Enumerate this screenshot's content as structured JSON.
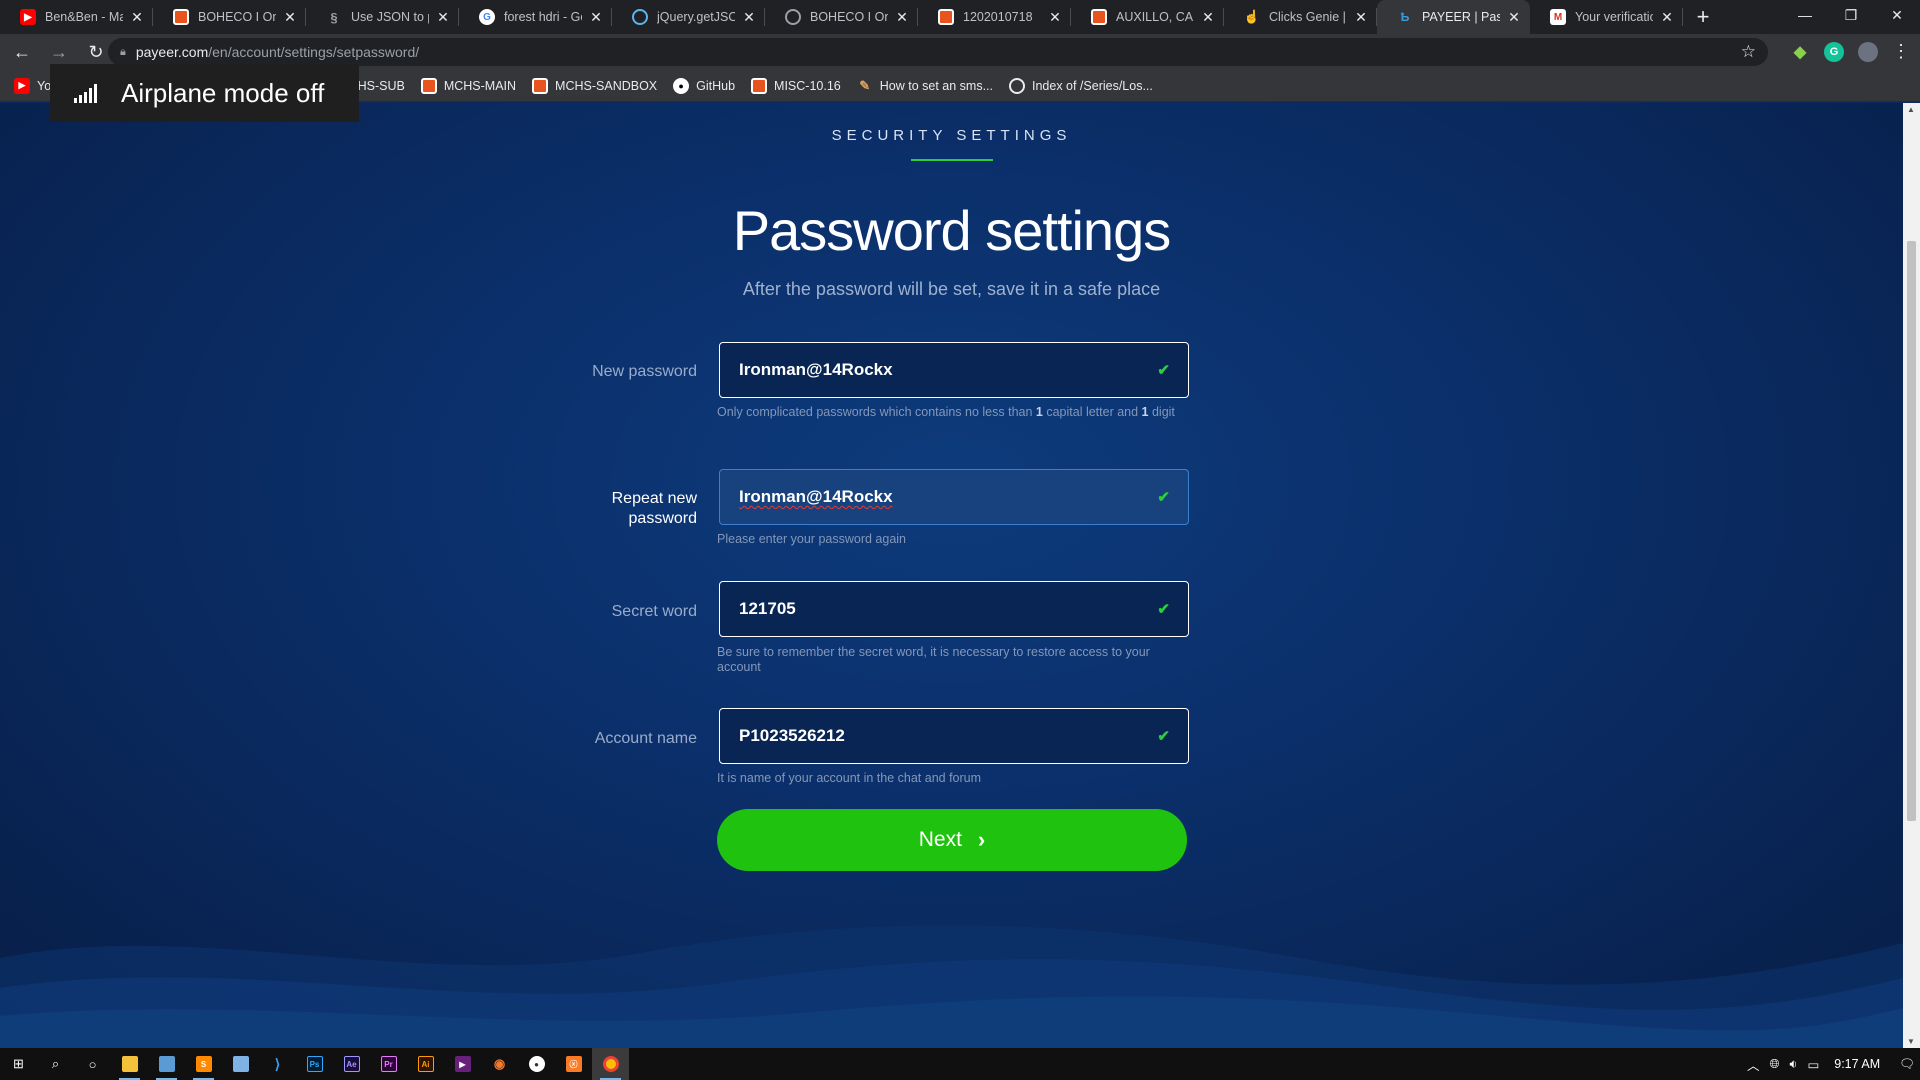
{
  "browser": {
    "tabs": [
      {
        "title": "Ben&Ben - Masy",
        "icon": "youtube-icon",
        "active": false
      },
      {
        "title": "BOHECO I Onlin",
        "icon": "boheco-icon",
        "active": false
      },
      {
        "title": "Use JSON to pas",
        "icon": "json-icon",
        "active": false
      },
      {
        "title": "forest hdri - Goo",
        "icon": "google-icon",
        "active": false
      },
      {
        "title": "jQuery.getJSON(",
        "icon": "jquery-icon",
        "active": false
      },
      {
        "title": "BOHECO I Onlin",
        "icon": "globe-icon",
        "active": false
      },
      {
        "title": "1202010718",
        "icon": "boheco-icon",
        "active": false
      },
      {
        "title": "AUXILLO, CALIX",
        "icon": "boheco-icon",
        "active": false
      },
      {
        "title": "Clicks Genie | Ge",
        "icon": "hand-icon",
        "active": false
      },
      {
        "title": "PAYEER | Passwo",
        "icon": "payeer-icon",
        "active": true
      },
      {
        "title": "Your verification",
        "icon": "gmail-icon",
        "active": false
      }
    ],
    "new_tab": "+",
    "url_host": "payeer.com",
    "url_path": "/en/account/settings/setpassword/",
    "bookmarks": [
      {
        "label": "Yo",
        "icon": "youtube-icon"
      },
      {
        "label": "MCHS-SUB",
        "icon": "boheco-icon"
      },
      {
        "label": "MCHS-MAIN",
        "icon": "boheco-icon"
      },
      {
        "label": "MCHS-SANDBOX",
        "icon": "boheco-icon"
      },
      {
        "label": "GitHub",
        "icon": "github-icon"
      },
      {
        "label": "MISC-10.16",
        "icon": "boheco-icon"
      },
      {
        "label": "How to set an sms...",
        "icon": "pin-icon"
      },
      {
        "label": "Index of /Series/Los...",
        "icon": "globe-icon"
      }
    ]
  },
  "toast": {
    "text": "Airplane mode off",
    "icon": "signal-icon"
  },
  "page": {
    "kicker": "SECURITY SETTINGS",
    "title": "Password settings",
    "subtitle": "After the password will be set, save it in a safe place",
    "fields": {
      "new_password": {
        "label": "New password",
        "value": "Ironman@14Rockx",
        "hint_pre": "Only complicated passwords which contains no less than ",
        "hint_b1": "1",
        "hint_mid": " capital letter and ",
        "hint_b2": "1",
        "hint_post": " digit"
      },
      "repeat_password": {
        "label_line1": "Repeat new",
        "label_line2": "password",
        "value": "Ironman@14Rockx",
        "hint": "Please enter your password again"
      },
      "secret_word": {
        "label": "Secret word",
        "value": "121705",
        "hint": "Be sure to remember the secret word, it is necessary to restore access to your account"
      },
      "account_name": {
        "label": "Account name",
        "value": "P1023526212",
        "hint": "It is name of your account in the chat and forum"
      }
    },
    "next_label": "Next"
  },
  "taskbar": {
    "clock": "9:17 AM"
  },
  "colors": {
    "accent_green": "#1fc30f",
    "check_green": "#2ecc40",
    "page_bg": "#0b2f6a"
  }
}
